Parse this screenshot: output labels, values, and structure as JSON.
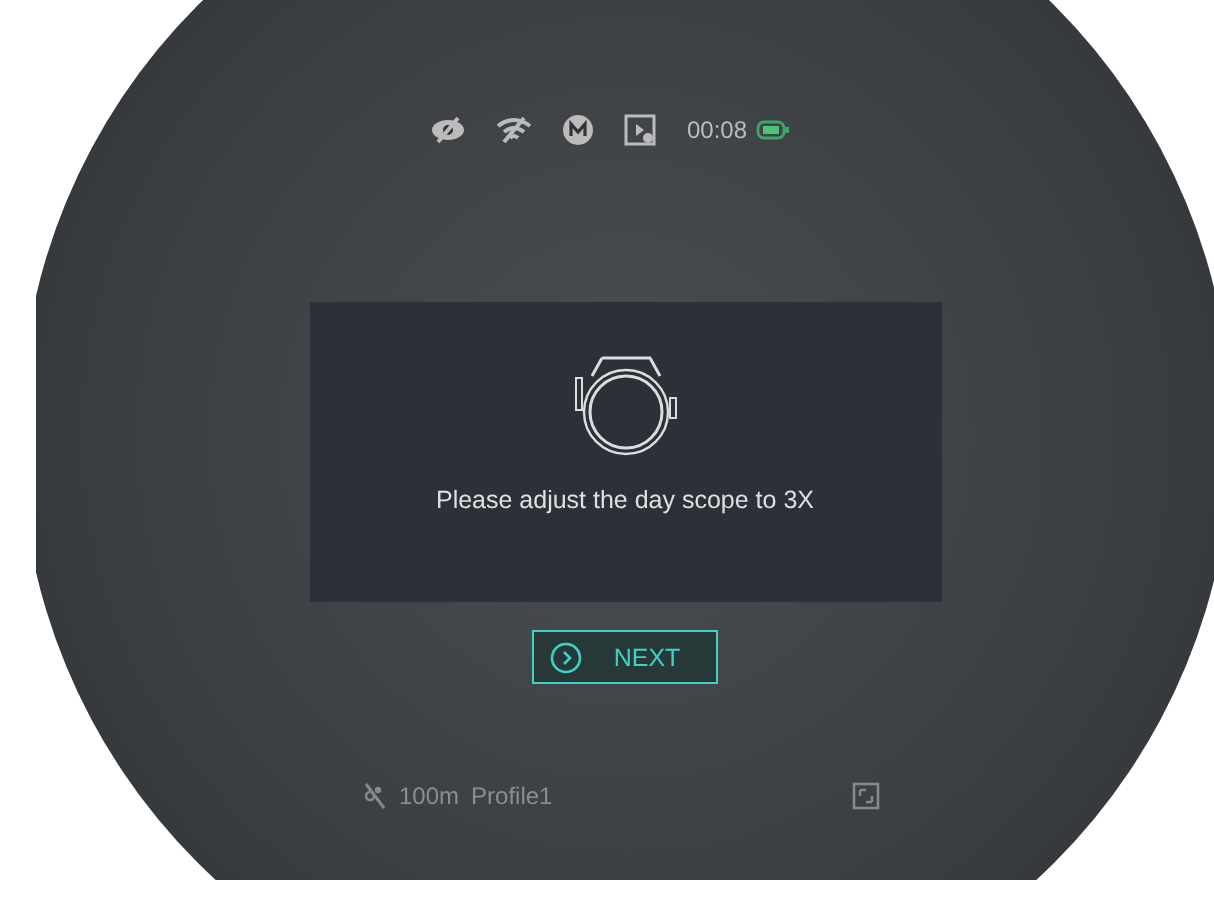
{
  "status_bar": {
    "time": "00:08"
  },
  "dialog": {
    "message": "Please adjust the day scope to 3X"
  },
  "button": {
    "label": "NEXT"
  },
  "bottom_bar": {
    "distance": "100m",
    "profile": "Profile1"
  }
}
